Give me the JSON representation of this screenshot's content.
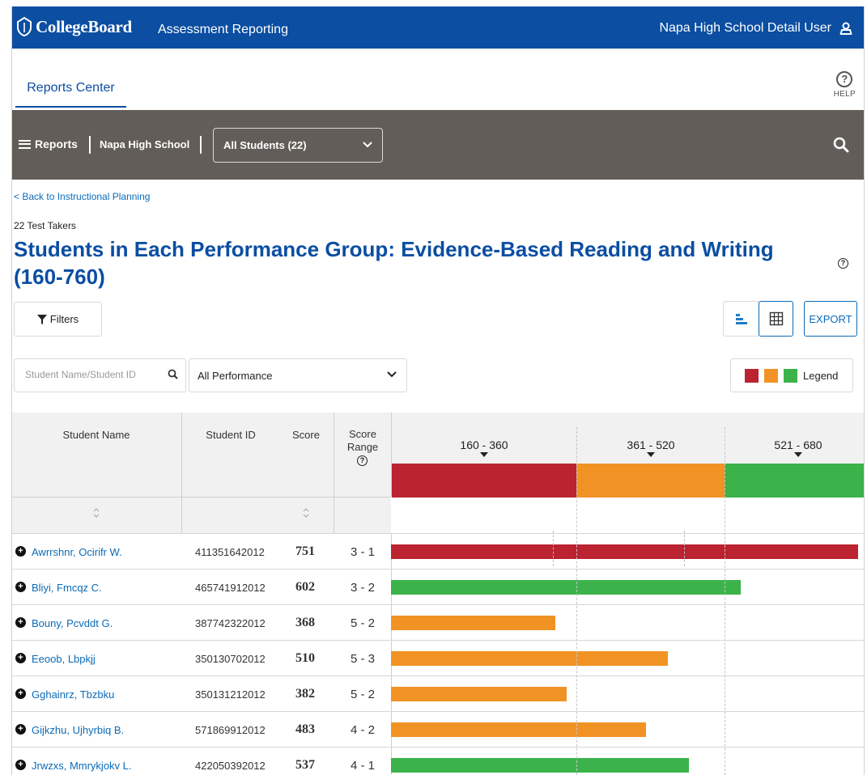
{
  "header": {
    "brand": "CollegeBoard",
    "app_title": "Assessment Reporting",
    "user": "Napa High School Detail User"
  },
  "tabs": {
    "reports_center": "Reports Center",
    "help": "HELP"
  },
  "nav": {
    "reports": "Reports",
    "school": "Napa High School",
    "students_select": "All Students (22)"
  },
  "page": {
    "back_link": "< Back to Instructional Planning",
    "test_takers": "22 Test Takers",
    "title_line1": "Students in Each Performance Group: Evidence-Based Reading and Writing",
    "title_line2": "(160-760)"
  },
  "toolbar": {
    "filters": "Filters",
    "export": "EXPORT",
    "search_placeholder": "Student Name/Student ID",
    "performance_select": "All Performance",
    "legend": "Legend"
  },
  "colors": {
    "brand": "#0b4ea2",
    "red": "#bb2330",
    "orange": "#f19324",
    "green": "#3bb34a"
  },
  "table": {
    "headers": {
      "name": "Student Name",
      "id": "Student ID",
      "score": "Score",
      "range_l1": "Score",
      "range_l2": "Range"
    },
    "bands": [
      {
        "label": "160 - 360",
        "color": "#bb2330"
      },
      {
        "label": "361 - 520",
        "color": "#f19324"
      },
      {
        "label": "521 - 680",
        "color": "#3bb34a"
      }
    ],
    "rows": [
      {
        "name": "Awrrshnr, Ocirifr W.",
        "id": "411351642012",
        "score": "751",
        "range": "3 - 1",
        "value": 751,
        "color": "#bb2330"
      },
      {
        "name": "Bliyi, Fmcqz C.",
        "id": "465741912012",
        "score": "602",
        "range": "3 - 2",
        "value": 602,
        "color": "#3bb34a"
      },
      {
        "name": "Bouny, Pcvddt G.",
        "id": "387742322012",
        "score": "368",
        "range": "5 - 2",
        "value": 368,
        "color": "#f19324"
      },
      {
        "name": "Eeoob, Lbpkjj",
        "id": "350130702012",
        "score": "510",
        "range": "5 - 3",
        "value": 510,
        "color": "#f19324"
      },
      {
        "name": "Gghainrz, Tbzbku",
        "id": "350131212012",
        "score": "382",
        "range": "5 - 2",
        "value": 382,
        "color": "#f19324"
      },
      {
        "name": "Gijkzhu, Ujhyrbiq B.",
        "id": "571869912012",
        "score": "483",
        "range": "4 - 2",
        "value": 483,
        "color": "#f19324"
      },
      {
        "name": "Jrwzxs, Mmrykjokv L.",
        "id": "422050392012",
        "score": "537",
        "range": "4 - 1",
        "value": 537,
        "color": "#3bb34a"
      }
    ]
  }
}
